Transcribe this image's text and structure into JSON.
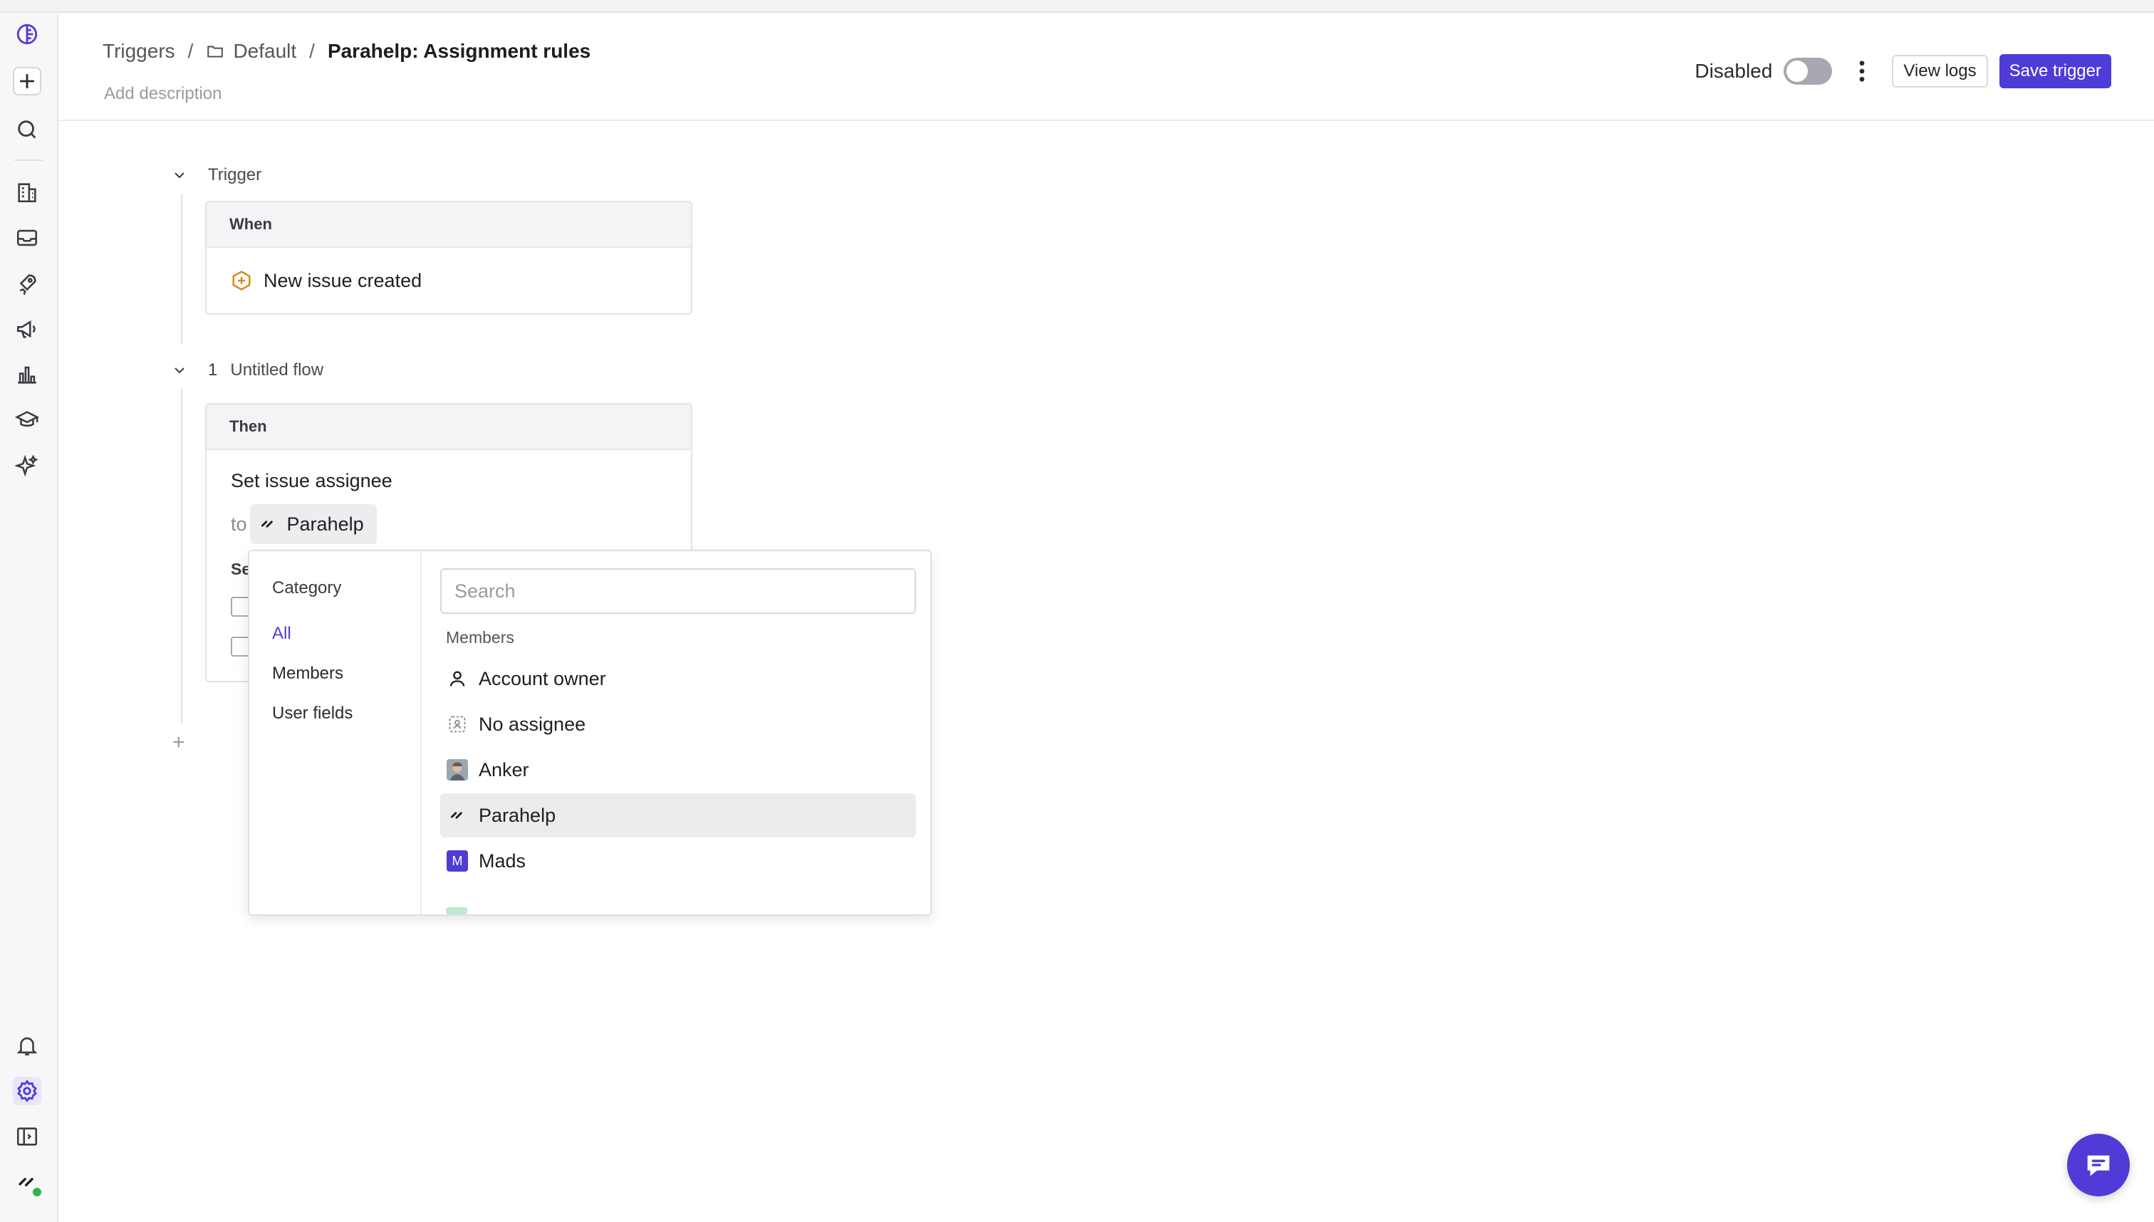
{
  "breadcrumb": {
    "root": "Triggers",
    "separator": "/",
    "folder": "Default",
    "current": "Parahelp: Assignment rules"
  },
  "header": {
    "add_description": "Add description",
    "status_label": "Disabled",
    "enabled": false,
    "view_logs": "View logs",
    "save": "Save trigger"
  },
  "trigger_section": {
    "label": "Trigger",
    "card_header": "When",
    "event": "New issue created"
  },
  "flow_section": {
    "number": "1",
    "label": "Untitled flow",
    "card_header": "Then",
    "action": "Set issue assignee",
    "to_label": "to",
    "assignee": "Parahelp",
    "partial_text": "Se"
  },
  "dropdown": {
    "category_title": "Category",
    "categories": [
      "All",
      "Members",
      "User fields"
    ],
    "active_category": "All",
    "search_placeholder": "Search",
    "group_label": "Members",
    "options": [
      {
        "label": "Account owner",
        "icon": "person-icon"
      },
      {
        "label": "No assignee",
        "icon": "no-assignee-icon"
      },
      {
        "label": "Anker",
        "icon": "avatar-photo"
      },
      {
        "label": "Parahelp",
        "icon": "parahelp-logo-icon"
      },
      {
        "label": "Mads",
        "icon": "initial-avatar",
        "initial": "M"
      }
    ],
    "selected": "Parahelp"
  },
  "colors": {
    "accent": "#4f3bd8",
    "event_icon": "#d98a1c"
  }
}
